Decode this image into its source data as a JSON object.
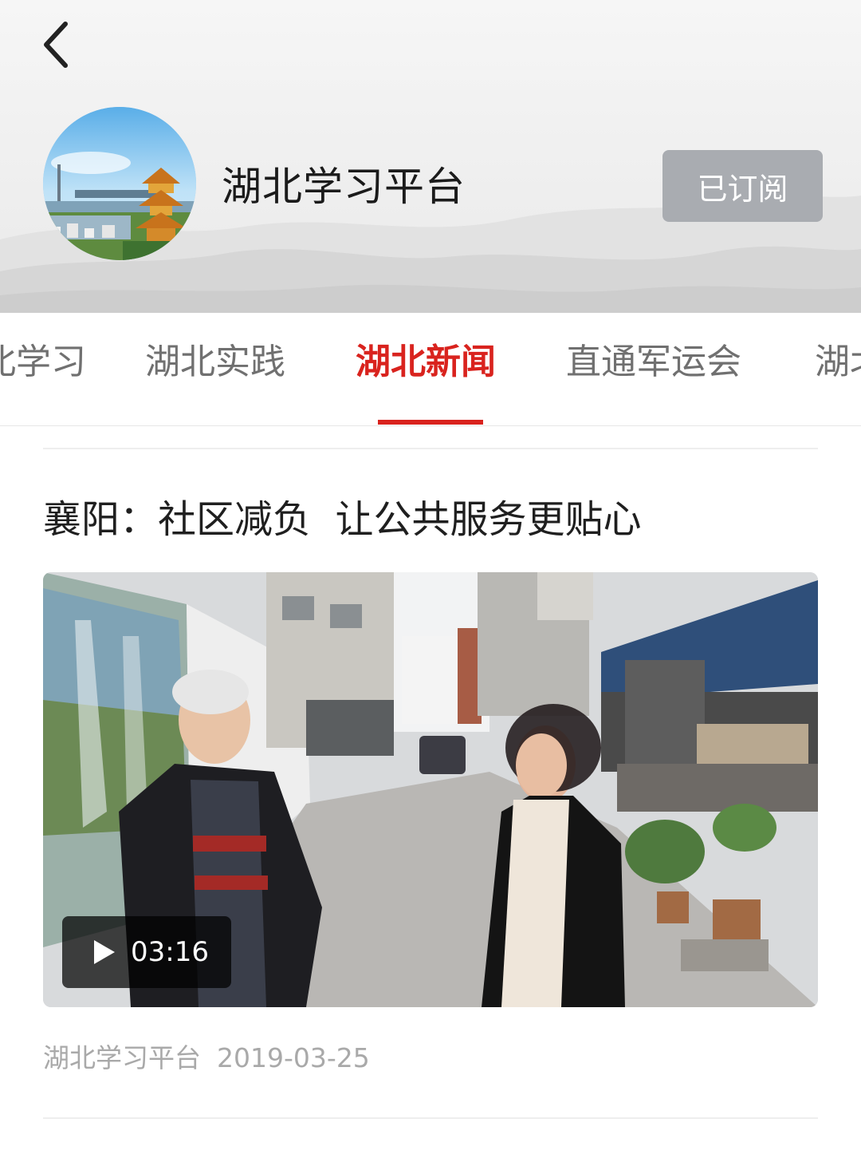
{
  "header": {
    "back_icon": "chevron-left-icon",
    "channel_name": "湖北学习平台",
    "subscribe_label": "已订阅"
  },
  "tabs": [
    {
      "label": "北学习",
      "active": false
    },
    {
      "label": "湖北实践",
      "active": false
    },
    {
      "label": "湖北新闻",
      "active": true
    },
    {
      "label": "直通军运会",
      "active": false
    },
    {
      "label": "湖北",
      "active": false
    }
  ],
  "article": {
    "title": "襄阳：社区减负  让公共服务更贴心",
    "video": {
      "duration": "03:16",
      "play_icon": "play-icon"
    },
    "source": "湖北学习平台",
    "date": "2019-03-25"
  },
  "colors": {
    "accent": "#d9231e",
    "subscribed_button": "#a9acb1",
    "meta_text": "#a9a9a9"
  }
}
